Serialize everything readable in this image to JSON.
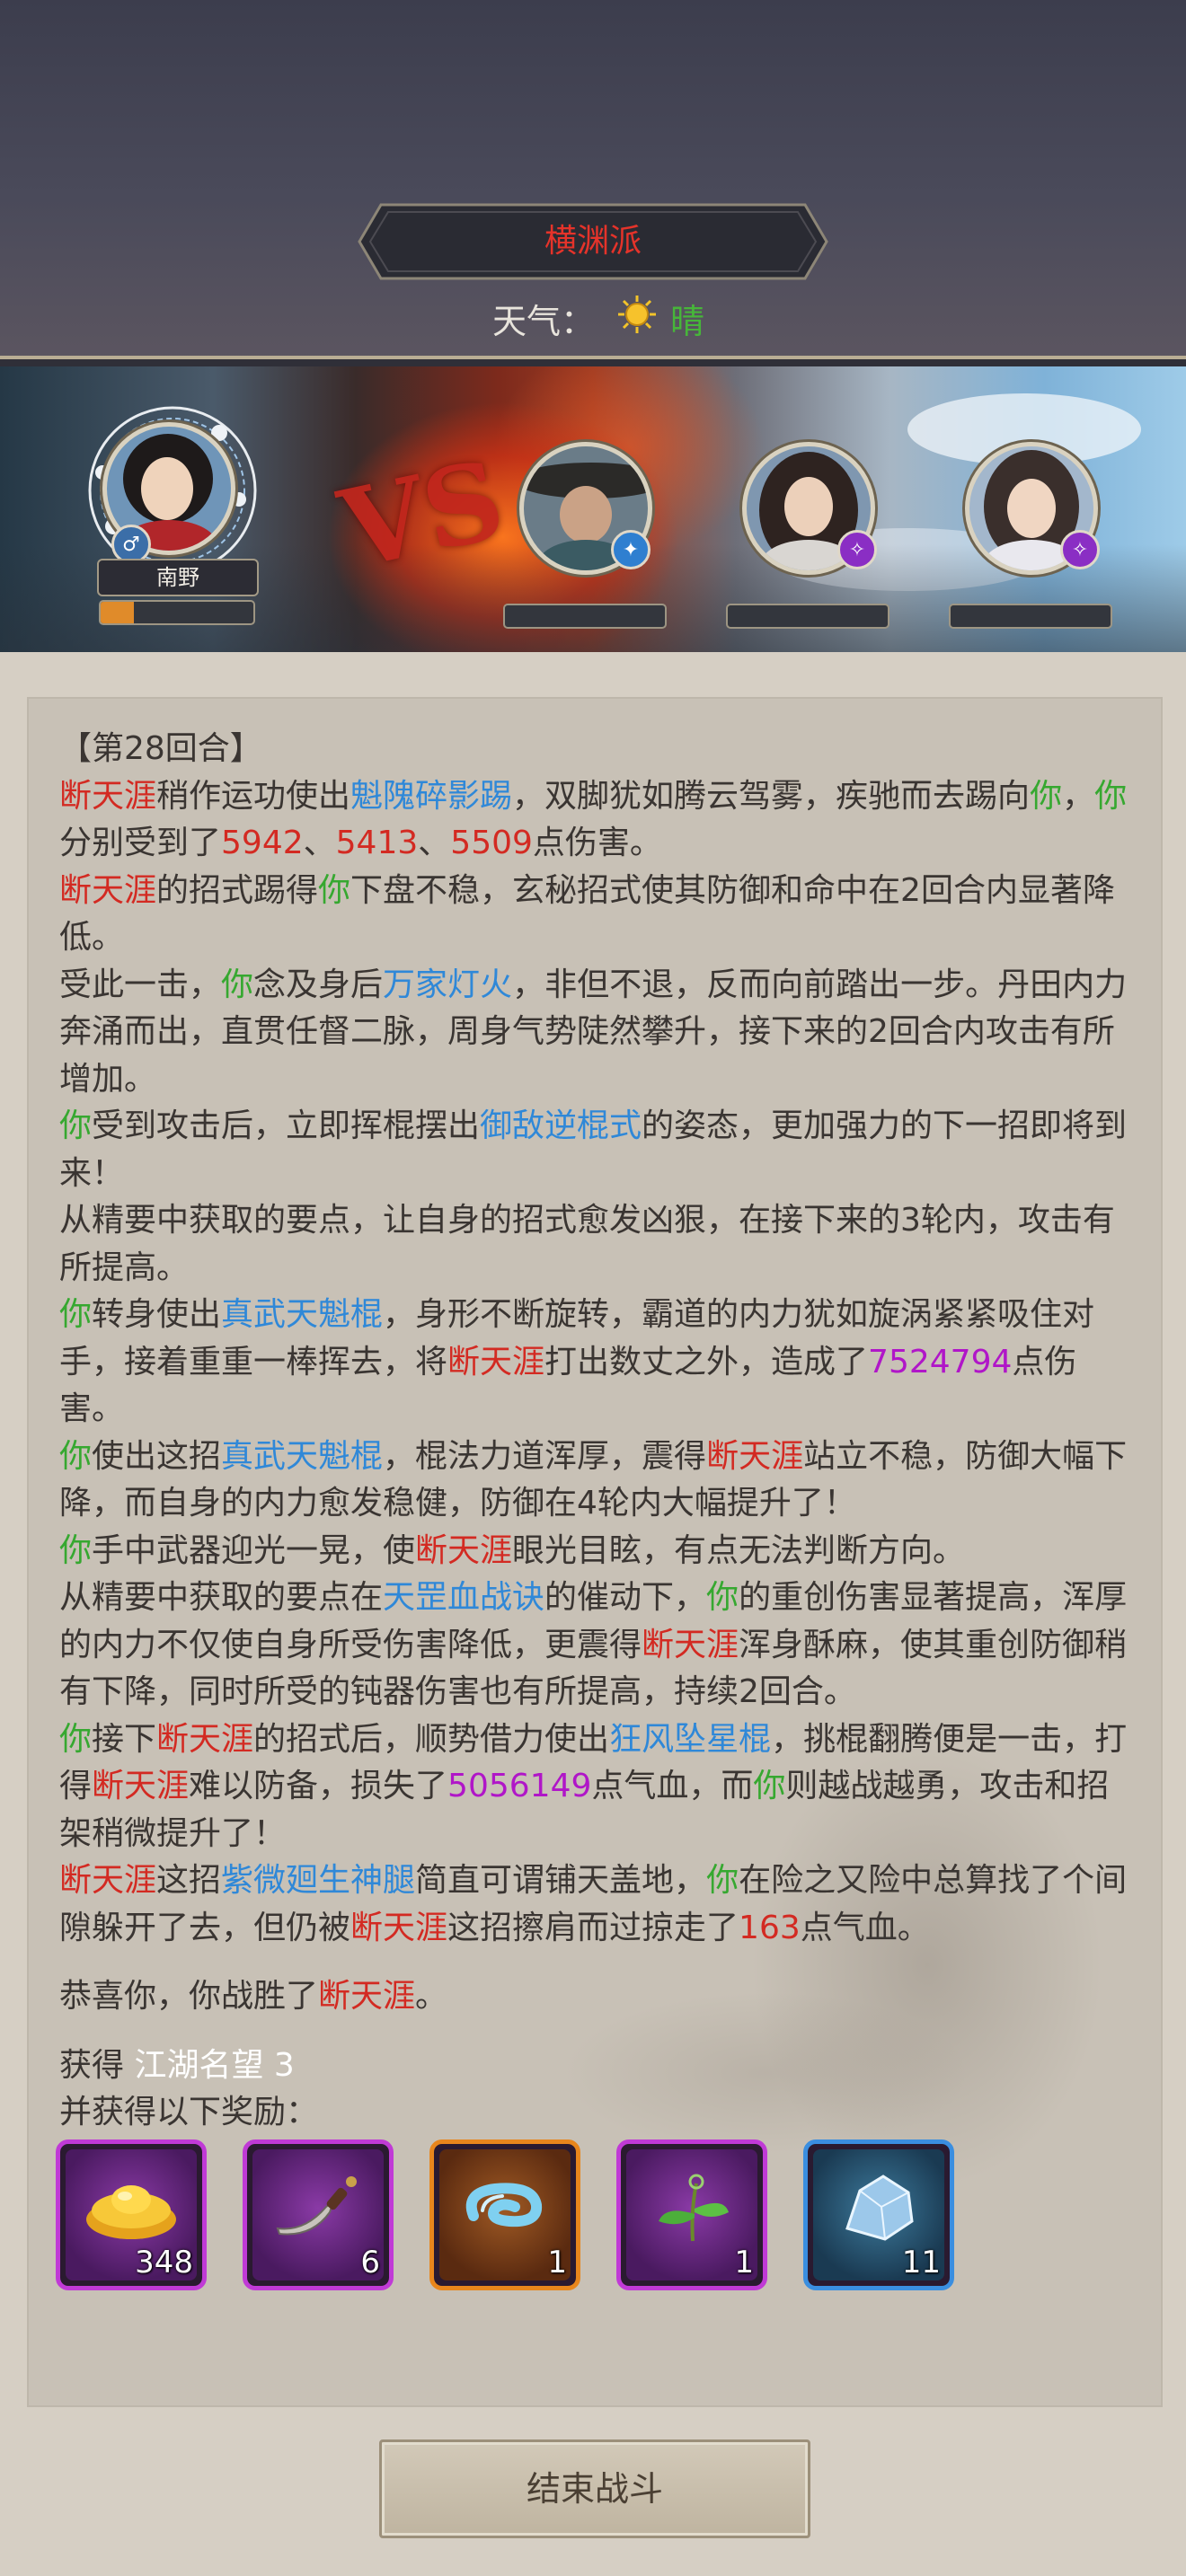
{
  "header": {
    "sect_name": "横渊派",
    "weather_label": "天气：",
    "weather_value": "晴"
  },
  "scene": {
    "player_name": "南野",
    "vs_text": "VS",
    "player_hp_fraction": 0.22
  },
  "log": {
    "round": "【第28回合】",
    "paragraphs": [
      [
        {
          "t": "断天涯",
          "c": "red"
        },
        {
          "t": "稍作运功使出"
        },
        {
          "t": "魁隗碎影踢",
          "c": "blue"
        },
        {
          "t": "，双脚犹如腾云驾雾，疾驰而去踢向"
        },
        {
          "t": "你",
          "c": "green"
        },
        {
          "t": "，"
        },
        {
          "t": "你",
          "c": "green"
        },
        {
          "t": "分别受到了"
        },
        {
          "t": "5942",
          "c": "red"
        },
        {
          "t": "、"
        },
        {
          "t": "5413",
          "c": "red"
        },
        {
          "t": "、"
        },
        {
          "t": "5509",
          "c": "red"
        },
        {
          "t": "点伤害。"
        }
      ],
      [
        {
          "t": "断天涯",
          "c": "red"
        },
        {
          "t": "的招式踢得"
        },
        {
          "t": "你",
          "c": "green"
        },
        {
          "t": "下盘不稳，玄秘招式使其防御和命中在2回合内显著降低。"
        }
      ],
      [
        {
          "t": "受此一击，"
        },
        {
          "t": "你",
          "c": "green"
        },
        {
          "t": "念及身后"
        },
        {
          "t": "万家灯火",
          "c": "blue"
        },
        {
          "t": "，非但不退，反而向前踏出一步。丹田内力奔涌而出，直贯任督二脉，周身气势陡然攀升，接下来的2回合内攻击有所增加。"
        }
      ],
      [
        {
          "t": "你",
          "c": "green"
        },
        {
          "t": "受到攻击后，立即挥棍摆出"
        },
        {
          "t": "御敌逆棍式",
          "c": "blue"
        },
        {
          "t": "的姿态，更加强力的下一招即将到来！"
        }
      ],
      [
        {
          "t": "从精要中获取的要点，让自身的招式愈发凶狠，在接下来的3轮内，攻击有所提高。"
        }
      ],
      [
        {
          "t": "你",
          "c": "green"
        },
        {
          "t": "转身使出"
        },
        {
          "t": "真武天魁棍",
          "c": "blue"
        },
        {
          "t": "，身形不断旋转，霸道的内力犹如旋涡紧紧吸住对手，接着重重一棒挥去，将"
        },
        {
          "t": "断天涯",
          "c": "red"
        },
        {
          "t": "打出数丈之外，造成了"
        },
        {
          "t": "7524794",
          "c": "purple"
        },
        {
          "t": "点伤害。"
        }
      ],
      [
        {
          "t": "你",
          "c": "green"
        },
        {
          "t": "使出这招"
        },
        {
          "t": "真武天魁棍",
          "c": "blue"
        },
        {
          "t": "，棍法力道浑厚，震得"
        },
        {
          "t": "断天涯",
          "c": "red"
        },
        {
          "t": "站立不稳，防御大幅下降，而自身的内力愈发稳健，防御在4轮内大幅提升了！"
        }
      ],
      [
        {
          "t": "你",
          "c": "green"
        },
        {
          "t": "手中武器迎光一晃，使"
        },
        {
          "t": "断天涯",
          "c": "red"
        },
        {
          "t": "眼光目眩，有点无法判断方向。"
        }
      ],
      [
        {
          "t": "从精要中获取的要点在"
        },
        {
          "t": "天罡血战诀",
          "c": "blue"
        },
        {
          "t": "的催动下，"
        },
        {
          "t": "你",
          "c": "green"
        },
        {
          "t": "的重创伤害显著提高，浑厚的内力不仅使自身所受伤害降低，更震得"
        },
        {
          "t": "断天涯",
          "c": "red"
        },
        {
          "t": "浑身酥麻，使其重创防御稍有下降，同时所受的钝器伤害也有所提高，持续2回合。"
        }
      ],
      [
        {
          "t": "你",
          "c": "green"
        },
        {
          "t": "接下"
        },
        {
          "t": "断天涯",
          "c": "red"
        },
        {
          "t": "的招式后，顺势借力使出"
        },
        {
          "t": "狂风坠星棍",
          "c": "blue"
        },
        {
          "t": "，挑棍翻腾便是一击，打得"
        },
        {
          "t": "断天涯",
          "c": "red"
        },
        {
          "t": "难以防备，损失了"
        },
        {
          "t": "5056149",
          "c": "purple"
        },
        {
          "t": "点气血，而"
        },
        {
          "t": "你",
          "c": "green"
        },
        {
          "t": "则越战越勇，攻击和招架稍微提升了！"
        }
      ],
      [
        {
          "t": "断天涯",
          "c": "red"
        },
        {
          "t": "这招"
        },
        {
          "t": "紫微廻生神腿",
          "c": "blue"
        },
        {
          "t": "简直可谓铺天盖地，"
        },
        {
          "t": "你",
          "c": "green"
        },
        {
          "t": "在险之又险中总算找了个间隙躲开了去，但仍被"
        },
        {
          "t": "断天涯",
          "c": "red"
        },
        {
          "t": "这招擦肩而过掠走了"
        },
        {
          "t": "163",
          "c": "red"
        },
        {
          "t": "点气血。"
        }
      ]
    ],
    "victory": [
      {
        "t": "恭喜你，你战胜了"
      },
      {
        "t": "断天涯",
        "c": "red"
      },
      {
        "t": "。"
      }
    ],
    "gain_label": "获得",
    "gain_value": "江湖名望 3",
    "reward_label": "并获得以下奖励："
  },
  "rewards": [
    {
      "icon": "gold-ingot-icon",
      "count": "348",
      "rarity": "purple"
    },
    {
      "icon": "dagger-icon",
      "count": "6",
      "rarity": "purple"
    },
    {
      "icon": "swirl-essence-icon",
      "count": "1",
      "rarity": "orange"
    },
    {
      "icon": "herb-icon",
      "count": "1",
      "rarity": "purple"
    },
    {
      "icon": "crystal-ore-icon",
      "count": "11",
      "rarity": "blue"
    }
  ],
  "colors": {
    "red": "#d32a22",
    "green": "#36a830",
    "blue": "#2f88d8",
    "purple": "#b016c8"
  },
  "footer": {
    "end_button": "结束战斗"
  }
}
